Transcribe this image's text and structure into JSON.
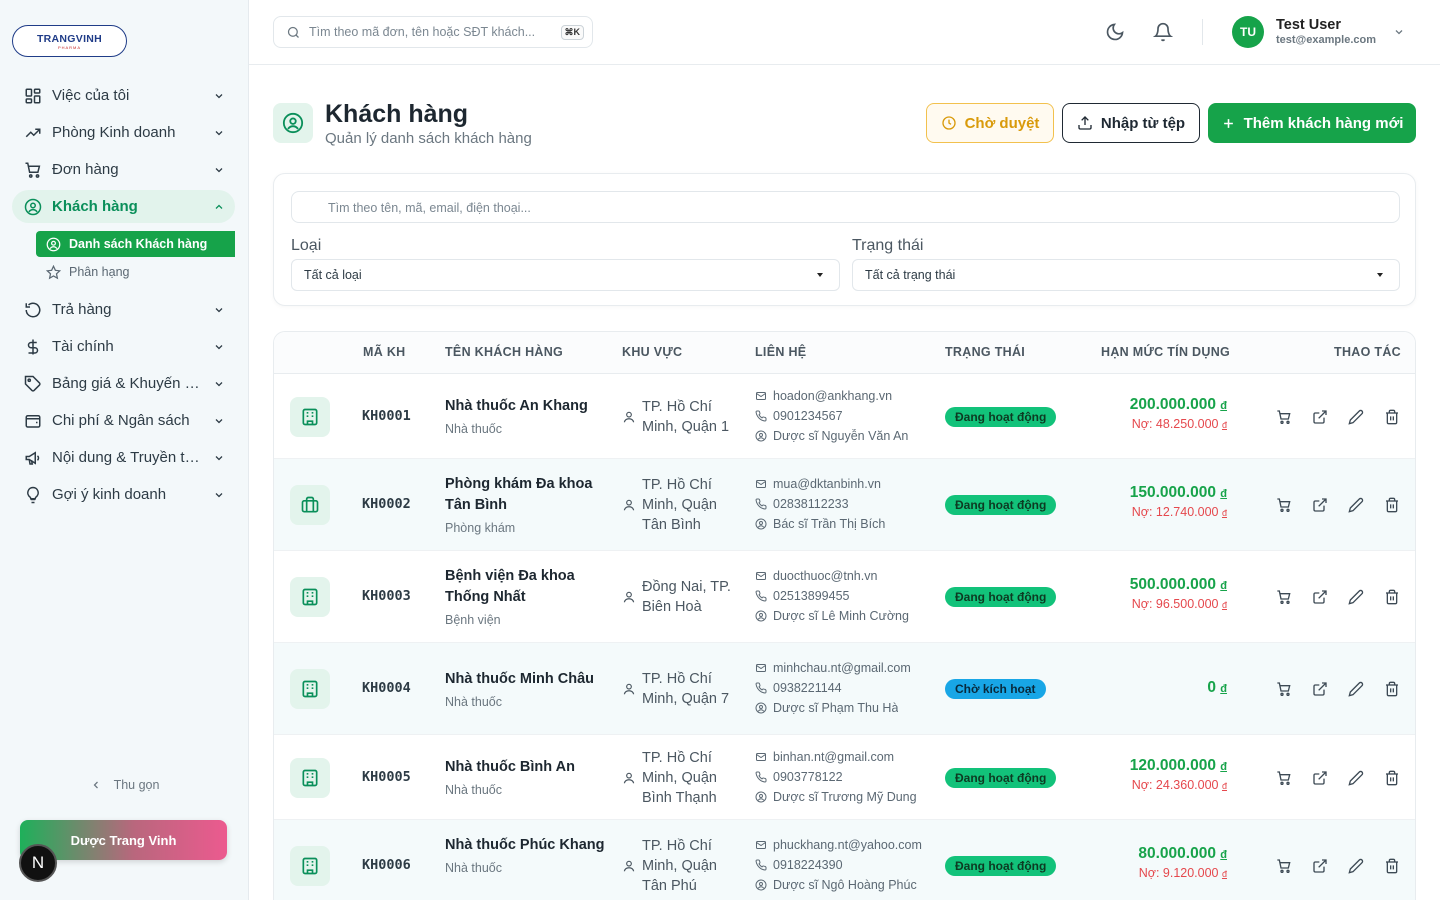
{
  "brand": {
    "logo_name": "TRANGVINH",
    "logo_sub": "PHARMA",
    "footer_label": "Dược Trang Vinh",
    "badge_letter": "N"
  },
  "sidebar": {
    "items": [
      {
        "label": "Việc của tôi",
        "icon": "grid-icon"
      },
      {
        "label": "Phòng Kinh doanh",
        "icon": "trending-up-icon"
      },
      {
        "label": "Đơn hàng",
        "icon": "cart-icon"
      },
      {
        "label": "Khách hàng",
        "icon": "user-circle-icon",
        "active": true
      },
      {
        "label": "Trả hàng",
        "icon": "rotate-icon"
      },
      {
        "label": "Tài chính",
        "icon": "dollar-icon"
      },
      {
        "label": "Bảng giá & Khuyến mãi",
        "icon": "tag-icon"
      },
      {
        "label": "Chi phí & Ngân sách",
        "icon": "wallet-icon"
      },
      {
        "label": "Nội dung & Truyền thông",
        "icon": "megaphone-icon"
      },
      {
        "label": "Gợi ý kinh doanh",
        "icon": "lightbulb-icon"
      }
    ],
    "sub_items": [
      {
        "label": "Danh sách Khách hàng",
        "active": true
      },
      {
        "label": "Phân hạng"
      }
    ],
    "collapse_label": "Thu gọn"
  },
  "header": {
    "search_placeholder": "Tìm theo mã đơn, tên hoặc SĐT khách...",
    "shortcut": "⌘K",
    "user_initials": "TU",
    "user_name": "Test User",
    "user_email": "test@example.com"
  },
  "page": {
    "title": "Khách hàng",
    "subtitle": "Quản lý danh sách khách hàng",
    "btn_pending": "Chờ duyệt",
    "btn_import": "Nhập từ tệp",
    "btn_add": "Thêm khách hàng mới"
  },
  "filters": {
    "search_placeholder": "Tìm theo tên, mã, email, điện thoại...",
    "type_label": "Loại",
    "type_value": "Tất cả loại",
    "status_label": "Trạng thái",
    "status_value": "Tất cả trạng thái"
  },
  "table": {
    "columns": {
      "code": "MÃ KH",
      "name": "TÊN KHÁCH HÀNG",
      "area": "KHU VỰC",
      "contact": "LIÊN HỆ",
      "status": "TRẠNG THÁI",
      "credit": "HẠN MỨC TÍN DỤNG",
      "actions": "THAO TÁC"
    },
    "currency": "đ",
    "rows": [
      {
        "code": "KH0001",
        "name": "Nhà thuốc An Khang",
        "type": "Nhà thuốc",
        "icon": "building-icon",
        "area": "TP. Hồ Chí Minh, Quận 1",
        "email": "hoadon@ankhang.vn",
        "phone": "0901234567",
        "person": "Dược sĩ Nguyễn Văn An",
        "status": "Đang hoạt động",
        "status_kind": "active",
        "limit": "200.000.000",
        "debt": "Nợ: 48.250.000"
      },
      {
        "code": "KH0002",
        "name": "Phòng khám Đa khoa Tân Bình",
        "type": "Phòng khám",
        "icon": "briefcase-icon",
        "area": "TP. Hồ Chí Minh, Quận Tân Bình",
        "email": "mua@dktanbinh.vn",
        "phone": "02838112233",
        "person": "Bác sĩ Trần Thị Bích",
        "status": "Đang hoạt động",
        "status_kind": "active",
        "limit": "150.000.000",
        "debt": "Nợ: 12.740.000"
      },
      {
        "code": "KH0003",
        "name": "Bệnh viện Đa khoa Thống Nhất",
        "type": "Bệnh viện",
        "icon": "building-icon",
        "area": "Đồng Nai, TP. Biên Hoà",
        "email": "duocthuoc@tnh.vn",
        "phone": "02513899455",
        "person": "Dược sĩ Lê Minh Cường",
        "status": "Đang hoạt động",
        "status_kind": "active",
        "limit": "500.000.000",
        "debt": "Nợ: 96.500.000"
      },
      {
        "code": "KH0004",
        "name": "Nhà thuốc Minh Châu",
        "type": "Nhà thuốc",
        "icon": "building-icon",
        "area": "TP. Hồ Chí Minh, Quận 7",
        "email": "minhchau.nt@gmail.com",
        "phone": "0938221144",
        "person": "Dược sĩ Phạm Thu Hà",
        "status": "Chờ kích hoạt",
        "status_kind": "wait",
        "limit": "0",
        "debt": ""
      },
      {
        "code": "KH0005",
        "name": "Nhà thuốc Bình An",
        "type": "Nhà thuốc",
        "icon": "building-icon",
        "area": "TP. Hồ Chí Minh, Quận Bình Thạnh",
        "email": "binhan.nt@gmail.com",
        "phone": "0903778122",
        "person": "Dược sĩ Trương Mỹ Dung",
        "status": "Đang hoạt động",
        "status_kind": "active",
        "limit": "120.000.000",
        "debt": "Nợ: 24.360.000"
      },
      {
        "code": "KH0006",
        "name": "Nhà thuốc Phúc Khang",
        "type": "Nhà thuốc",
        "icon": "building-icon",
        "area": "TP. Hồ Chí Minh, Quận Tân Phú",
        "email": "phuckhang.nt@yahoo.com",
        "phone": "0918224390",
        "person": "Dược sĩ Ngô Hoàng Phúc",
        "status": "Đang hoạt động",
        "status_kind": "active",
        "limit": "80.000.000",
        "debt": "Nợ: 9.120.000"
      }
    ]
  },
  "colors": {
    "primary": "#16a34a",
    "active_badge": "#12c27a",
    "wait_badge": "#18a6e6",
    "debt": "#e5484d",
    "pending": "#d99a0a"
  }
}
